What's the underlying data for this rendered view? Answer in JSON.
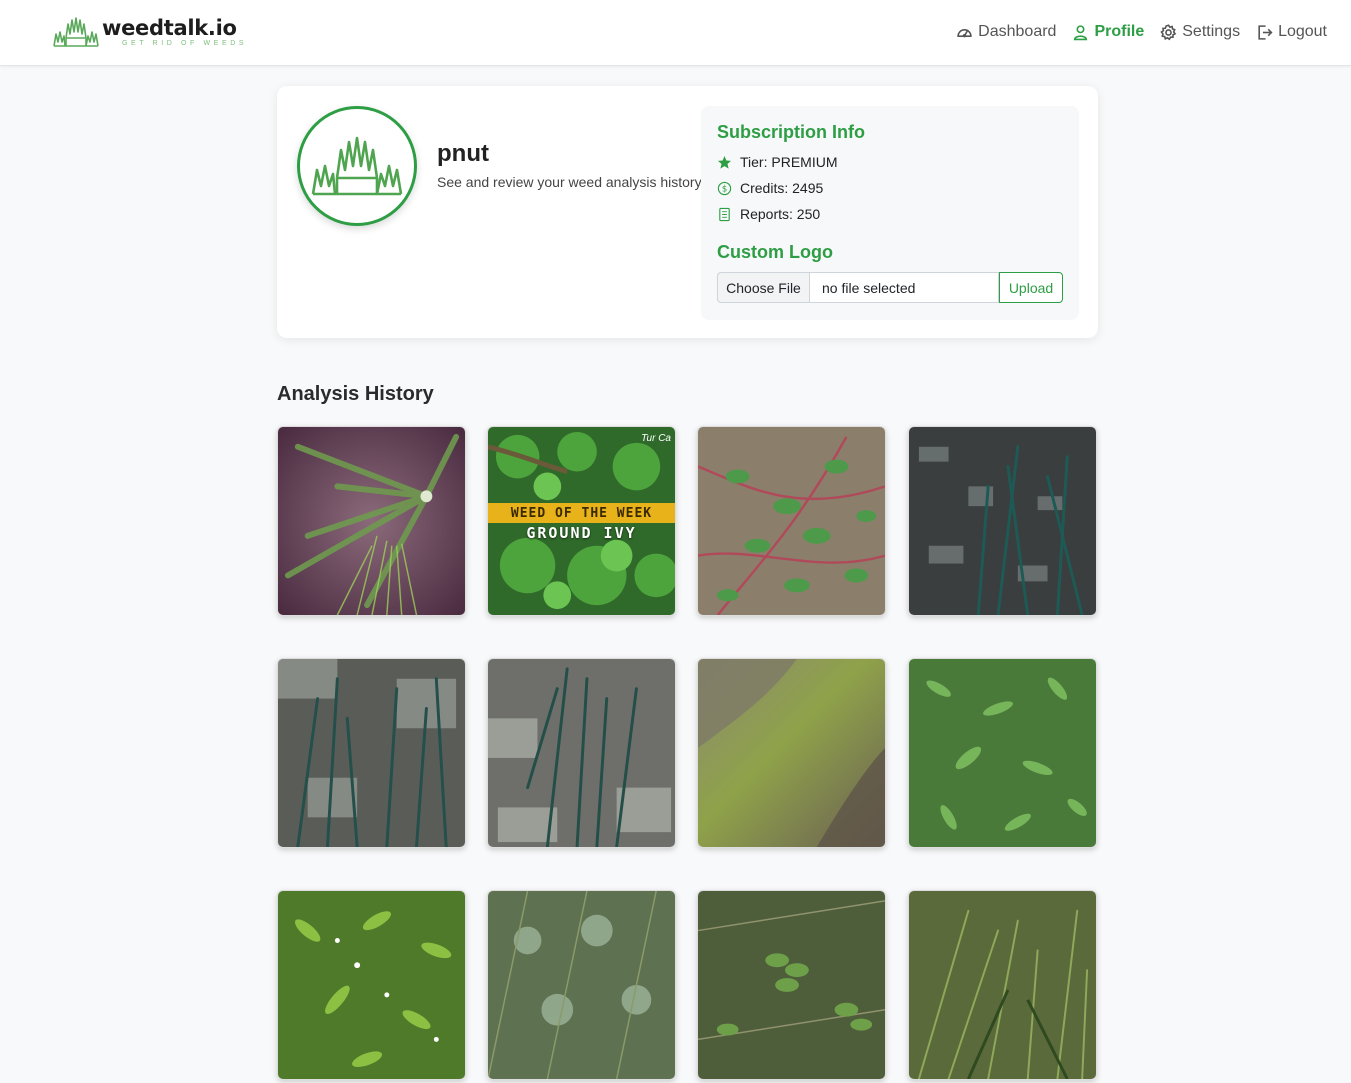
{
  "brand": {
    "name": "weedtalk.io",
    "tagline": "GET RID OF WEEDS",
    "logo_icon": "grass-logo"
  },
  "nav": {
    "items": [
      {
        "label": "Dashboard",
        "icon": "dashboard-gauge-icon",
        "active": false
      },
      {
        "label": "Profile",
        "icon": "user-icon",
        "active": true
      },
      {
        "label": "Settings",
        "icon": "gear-icon",
        "active": false
      },
      {
        "label": "Logout",
        "icon": "logout-icon",
        "active": false
      }
    ]
  },
  "profile": {
    "username": "pnut",
    "subtitle": "See and review your weed analysis history",
    "avatar_icon": "grass-logo"
  },
  "subscription": {
    "title": "Subscription Info",
    "tier": "Tier: PREMIUM",
    "credits": "Credits: 2495",
    "reports": "Reports: 250"
  },
  "custom_logo": {
    "title": "Custom Logo",
    "choose_label": "Choose File",
    "file_status": "no file selected",
    "upload_label": "Upload"
  },
  "history": {
    "title": "Analysis History",
    "thumbnails": [
      {
        "overlay_line1": "WEED OF THE WEEK",
        "overlay_line2": "GROUND IVY",
        "corner_text": "Tur Ca"
      }
    ]
  },
  "colors": {
    "accent": "#2e9e45",
    "background": "#f8f9fa",
    "banner": "#e8b21a"
  }
}
